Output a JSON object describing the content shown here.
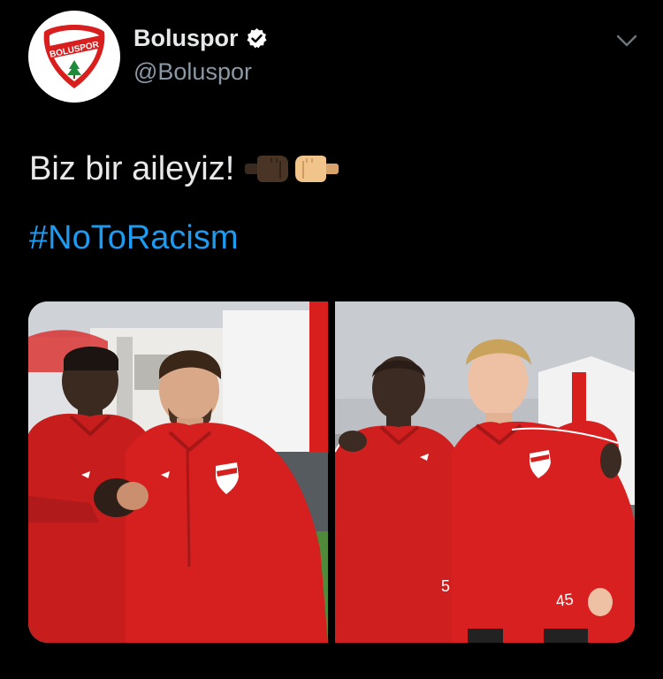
{
  "account": {
    "display_name": "Boluspor",
    "handle": "@Boluspor",
    "verified": true,
    "avatar_icon": "boluspor-crest-icon",
    "avatar_text": "BOLUSPOR"
  },
  "tweet": {
    "text": "Biz bir aileyiz!",
    "emojis": [
      "dark-fist-icon",
      "light-fist-icon"
    ],
    "hashtag": "#NoToRacism"
  },
  "media": {
    "photos": [
      {
        "name": "photo-left",
        "description_icon": "two-players-handshake-photo",
        "jersey_numbers": []
      },
      {
        "name": "photo-right",
        "description_icon": "two-players-arm-over-shoulder-photo",
        "jersey_numbers": [
          "5",
          "45"
        ]
      }
    ]
  },
  "colors": {
    "background": "#000000",
    "text": "#e7e9ea",
    "secondary_text": "#8b98a5",
    "link": "#1d9bf0",
    "club_red": "#d91e1e"
  }
}
